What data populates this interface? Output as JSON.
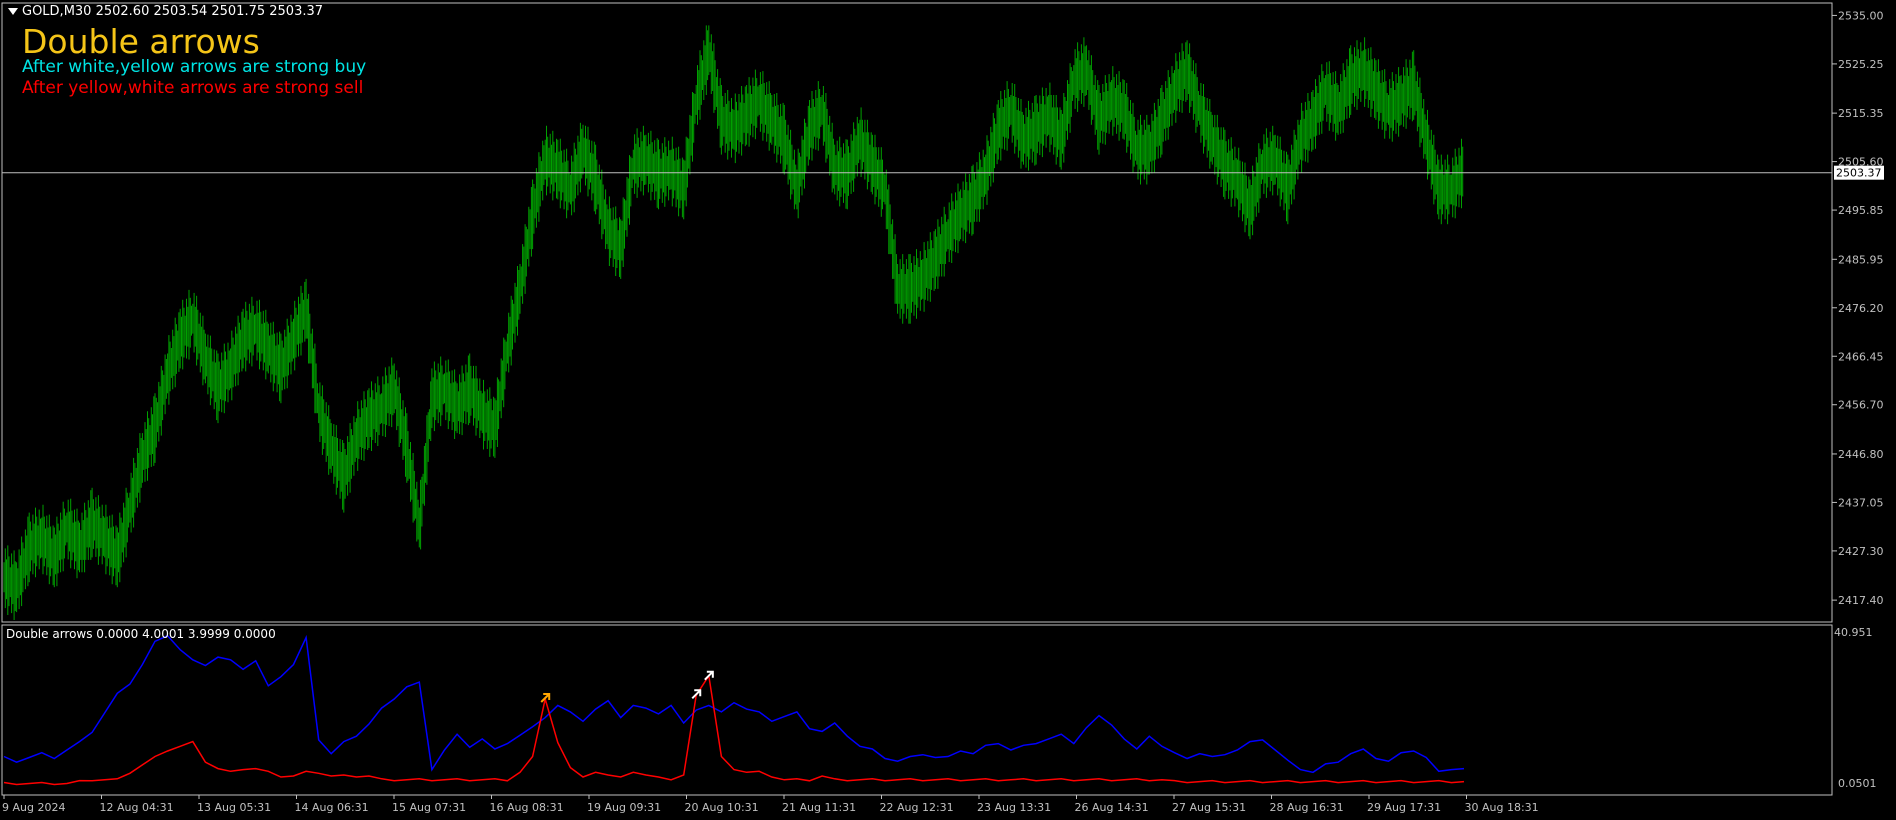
{
  "header": {
    "symbol_line": "GOLD,M30  2502.60 2503.54 2501.75 2503.37"
  },
  "overlay": {
    "title": "Double arrows",
    "note_buy": "After white,yellow arrows are strong buy",
    "note_sell": "After yellow,white arrows are strong sell",
    "colors": {
      "title": "#f5c518",
      "note_buy": "#00e5e5",
      "note_sell": "#ff0000"
    }
  },
  "subwindow": {
    "label": "Double arrows 0.0000 4.0001 3.9999 0.0000",
    "axis": {
      "max_label": "40.951",
      "min_label": "0.0501"
    }
  },
  "chart_data": [
    {
      "type": "line",
      "description_role": "price",
      "title": "",
      "color": "#00a000",
      "y_ticks": [
        "2535.00",
        "2525.25",
        "2515.35",
        "2505.60",
        "2495.85",
        "2485.95",
        "2476.20",
        "2466.45",
        "2456.70",
        "2446.80",
        "2437.05",
        "2427.30",
        "2417.40"
      ],
      "ylim": [
        2413.0,
        2537.5
      ],
      "current_price": {
        "label": "2503.37",
        "value": 2503.37
      },
      "x_ticks": [
        "9 Aug 2024",
        "12 Aug 04:31",
        "13 Aug 05:31",
        "14 Aug 06:31",
        "15 Aug 07:31",
        "16 Aug 08:31",
        "19 Aug 09:31",
        "20 Aug 10:31",
        "21 Aug 11:31",
        "22 Aug 12:31",
        "23 Aug 13:31",
        "26 Aug 14:31",
        "27 Aug 15:31",
        "28 Aug 16:31",
        "29 Aug 17:31",
        "30 Aug 18:31"
      ],
      "series": [
        {
          "values": [
            2422,
            2420,
            2428,
            2430,
            2426,
            2432,
            2428,
            2433,
            2430,
            2426,
            2436,
            2446,
            2452,
            2463,
            2470,
            2474,
            2466,
            2460,
            2464,
            2470,
            2472,
            2468,
            2464,
            2470,
            2476,
            2456,
            2448,
            2442,
            2450,
            2454,
            2456,
            2460,
            2448,
            2432,
            2458,
            2460,
            2456,
            2460,
            2455,
            2452,
            2468,
            2480,
            2495,
            2506,
            2504,
            2500,
            2508,
            2502,
            2492,
            2488,
            2505,
            2506,
            2503,
            2504,
            2500,
            2518,
            2528,
            2514,
            2512,
            2515,
            2518,
            2514,
            2510,
            2500,
            2512,
            2516,
            2504,
            2503,
            2510,
            2505,
            2500,
            2480,
            2480,
            2482,
            2486,
            2491,
            2495,
            2498,
            2503,
            2512,
            2516,
            2510,
            2512,
            2515,
            2510,
            2522,
            2524,
            2514,
            2518,
            2516,
            2508,
            2508,
            2514,
            2520,
            2524,
            2516,
            2510,
            2505,
            2502,
            2496,
            2505,
            2506,
            2500,
            2510,
            2514,
            2520,
            2516,
            2522,
            2524,
            2520,
            2516,
            2518,
            2521,
            2510,
            2500,
            2500,
            2504
          ]
        }
      ]
    },
    {
      "type": "line",
      "description_role": "indicator",
      "title": "",
      "ylim": [
        0.0501,
        40.951
      ],
      "series": [
        {
          "color": "#0000ff",
          "values": [
            8,
            7,
            8,
            9,
            8,
            10,
            12,
            15,
            20,
            25,
            28,
            33,
            39,
            41,
            37,
            34,
            33,
            35,
            34,
            32,
            34,
            27,
            30,
            33,
            40,
            13,
            9,
            12,
            14,
            17,
            21,
            24,
            27,
            28,
            5,
            10,
            14,
            11,
            13,
            10,
            12,
            14,
            16,
            19,
            22,
            20,
            18,
            21,
            23,
            19,
            22,
            21,
            20,
            22,
            17,
            21,
            22,
            20,
            23,
            21,
            20,
            18,
            19,
            20,
            16,
            15,
            17,
            14,
            11,
            10,
            8,
            7,
            8,
            9,
            8,
            8,
            10,
            9,
            11,
            12,
            10,
            11,
            12,
            13,
            14,
            12,
            16,
            19,
            17,
            13,
            10,
            14,
            11,
            9,
            8,
            9,
            8,
            9,
            10,
            12,
            13,
            10,
            7,
            5,
            4,
            6,
            7,
            9,
            10,
            8,
            7,
            9,
            10,
            8,
            4,
            5,
            5
          ]
        },
        {
          "color": "#ff0000",
          "values": [
            1,
            1,
            1,
            1,
            1,
            1,
            1.5,
            2,
            2,
            2,
            4,
            6,
            8,
            10,
            11,
            12,
            7,
            5,
            4,
            5,
            5,
            4,
            3,
            3,
            4,
            4,
            3,
            3,
            3,
            3,
            2,
            2,
            2,
            2,
            2,
            2,
            2,
            2,
            2,
            2,
            2,
            4,
            8,
            24,
            12,
            5,
            3,
            4,
            3,
            3,
            4,
            3,
            3,
            2,
            3,
            25,
            30,
            8,
            5,
            4,
            4,
            3,
            2,
            2,
            2,
            3,
            2,
            2,
            2,
            2,
            2,
            2,
            2,
            2,
            2,
            2,
            2,
            2,
            2,
            2,
            2,
            2,
            2,
            2,
            2,
            2,
            2,
            2,
            2,
            2,
            2,
            2,
            2,
            1.5,
            1.5,
            1.5,
            1.5,
            1.5,
            1.5,
            1.5,
            1.5,
            1.5,
            1.5,
            1.5,
            1.5,
            1.5,
            1.5,
            1.5,
            1.5,
            1.5,
            1.5,
            1.5,
            1.5,
            1.5,
            1.5,
            1.5,
            1.5
          ]
        }
      ],
      "markers": [
        {
          "kind": "arrow",
          "color": "#ffa500",
          "index": 43,
          "value": 24
        },
        {
          "kind": "arrow",
          "color": "#ffffff",
          "index": 55,
          "value": 25
        },
        {
          "kind": "arrow",
          "color": "#ffffff",
          "index": 56,
          "value": 30
        }
      ]
    }
  ]
}
